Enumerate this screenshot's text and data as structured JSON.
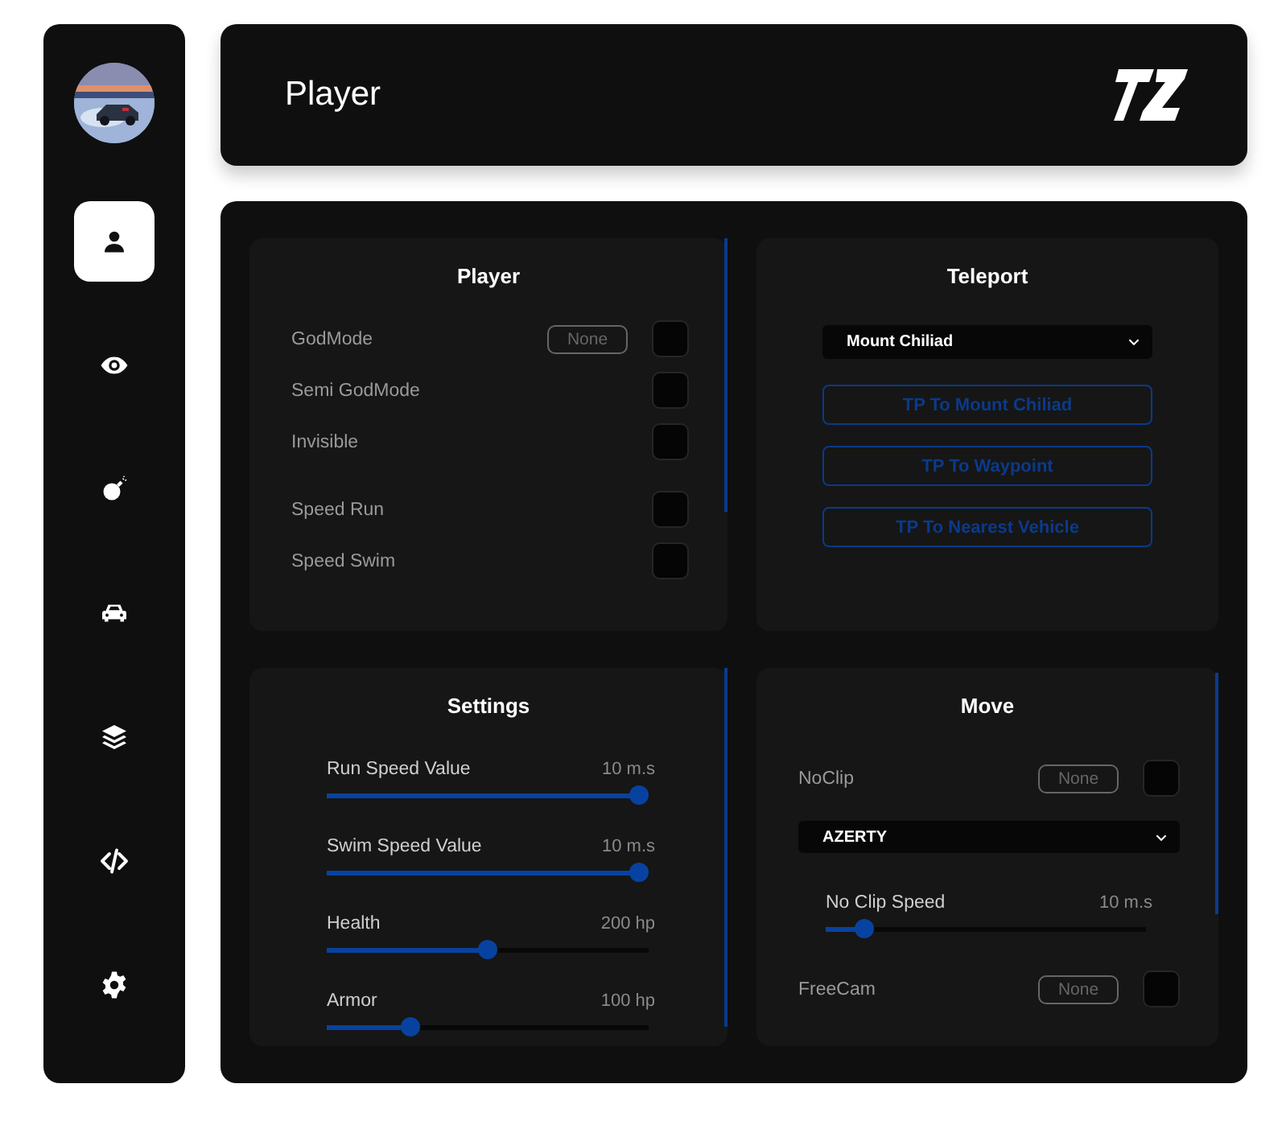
{
  "sidebar": {
    "nav": [
      {
        "kind": "person",
        "selected": true
      },
      {
        "kind": "eye",
        "selected": false
      },
      {
        "kind": "bomb",
        "selected": false
      },
      {
        "kind": "car",
        "selected": false
      },
      {
        "kind": "layers",
        "selected": false
      },
      {
        "kind": "code",
        "selected": false
      },
      {
        "kind": "gear",
        "selected": false
      }
    ]
  },
  "header": {
    "title": "Player"
  },
  "player": {
    "title": "Player",
    "rows": [
      {
        "label": "GodMode",
        "keybind": "None",
        "checked": false
      },
      {
        "label": "Semi GodMode",
        "checked": false
      },
      {
        "label": "Invisible",
        "checked": false
      },
      {
        "label": "Speed Run",
        "checked": false
      },
      {
        "label": "Speed Swim",
        "checked": false
      }
    ]
  },
  "teleport": {
    "title": "Teleport",
    "location": "Mount Chiliad",
    "buttons": [
      "TP To  Mount Chiliad",
      "TP To Waypoint",
      "TP To Nearest Vehicle"
    ]
  },
  "settings": {
    "title": "Settings",
    "sliders": [
      {
        "label": "Run Speed Value",
        "reading": "10 m.s",
        "level": 0.97
      },
      {
        "label": "Swim Speed Value",
        "reading": "10 m.s",
        "level": 0.97
      },
      {
        "label": "Health",
        "reading": "200 hp",
        "level": 0.5
      },
      {
        "label": "Armor",
        "reading": "100 hp",
        "level": 0.26
      }
    ]
  },
  "move": {
    "title": "Move",
    "items": [
      {
        "kind": "toggle",
        "label": "NoClip",
        "keybind": "None",
        "checked": false
      },
      {
        "kind": "select",
        "value": "AZERTY"
      },
      {
        "kind": "slider",
        "label": "No Clip Speed",
        "reading": "10 m.s",
        "level": 0.12
      },
      {
        "kind": "toggle",
        "label": "FreeCam",
        "keybind": "None",
        "checked": false
      }
    ]
  }
}
